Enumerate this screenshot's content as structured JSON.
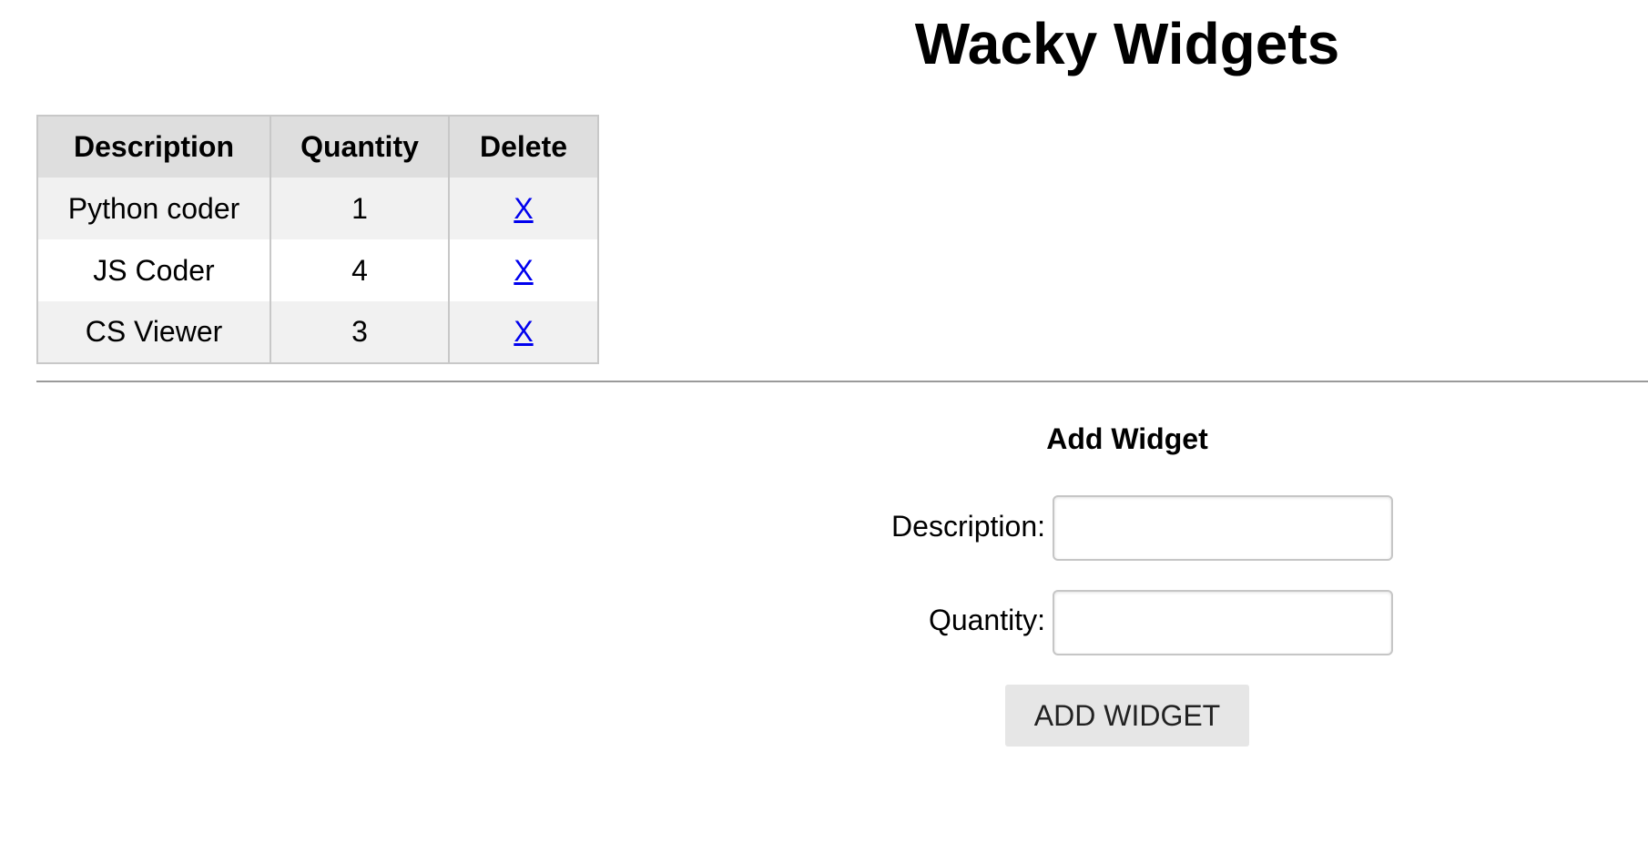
{
  "header": {
    "title": "Wacky Widgets"
  },
  "table": {
    "headers": {
      "description": "Description",
      "quantity": "Quantity",
      "delete": "Delete"
    },
    "rows": [
      {
        "description": "Python coder",
        "quantity": "1",
        "delete": "X"
      },
      {
        "description": "JS Coder",
        "quantity": "4",
        "delete": "X"
      },
      {
        "description": "CS Viewer",
        "quantity": "3",
        "delete": "X"
      }
    ]
  },
  "form": {
    "heading": "Add Widget",
    "description_label": "Description:",
    "description_value": "",
    "quantity_label": "Quantity:",
    "quantity_value": "",
    "submit_label": "ADD WIDGET"
  },
  "colors": {
    "link": "#0000ee",
    "header_bg": "#dedede",
    "row_alt_bg": "#f1f1f1",
    "button_bg": "#e6e6e6"
  }
}
